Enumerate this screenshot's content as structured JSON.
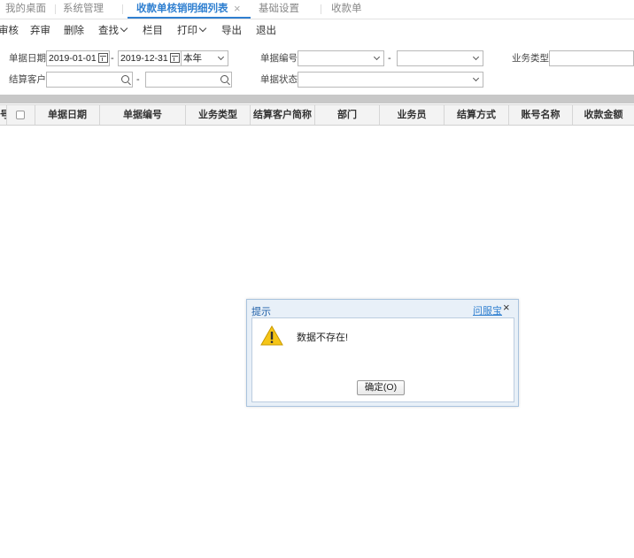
{
  "tabs": [
    {
      "label": "我的桌面"
    },
    {
      "label": "系统管理"
    },
    {
      "label": "收款单核销明细列表",
      "close": "×"
    },
    {
      "label": "基础设置"
    },
    {
      "label": "收款单"
    }
  ],
  "toolbar": {
    "audit": "审核",
    "unaudit": "弃审",
    "delete": "删除",
    "find": "查找",
    "columns": "栏目",
    "print": "打印",
    "export": "导出",
    "exit": "退出"
  },
  "filters": {
    "date_label": "单据日期",
    "date_from": "2019-01-01",
    "date_to": "2019-12-31",
    "period": "本年",
    "number_label": "单据编号",
    "business_type_label": "业务类型",
    "customer_label": "结算客户",
    "status_label": "单据状态",
    "range_sep": "-"
  },
  "table": {
    "columns": [
      "号",
      "",
      "单据日期",
      "单据编号",
      "业务类型",
      "结算客户简称",
      "部门",
      "业务员",
      "结算方式",
      "账号名称",
      "收款金额"
    ]
  },
  "dialog": {
    "title": "提示",
    "help": "问服宝",
    "close": "×",
    "message": "数据不存在!",
    "ok": "确定(O)"
  },
  "colors": {
    "accent": "#2f7fd0",
    "warning": "#f5c518"
  }
}
